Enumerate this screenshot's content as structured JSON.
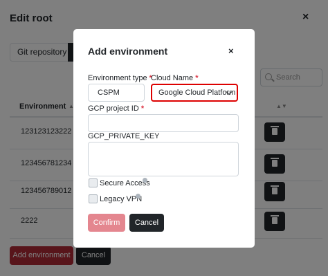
{
  "background": {
    "title": "Edit root",
    "close": "×",
    "tab_label": "Git repository",
    "search_placeholder": "Search",
    "column_header": "Environment",
    "rows": [
      "123123123222",
      "123456781234",
      "123456789012",
      "2222"
    ],
    "add_button": "Add environment",
    "cancel_button": "Cancel"
  },
  "modal": {
    "title": "Add environment",
    "close": "×",
    "env_type_label": "Environment type",
    "env_type_value": "CSPM",
    "cloud_name_label": "Cloud Name",
    "cloud_name_value": "Google Cloud Platform",
    "project_id_label": "GCP project ID",
    "private_key_label": "GCP_PRIVATE_KEY",
    "secure_access_label": "Secure Access",
    "legacy_vpn_label": "Legacy VPN",
    "confirm_button": "Confirm",
    "cancel_button": "Cancel",
    "required_mark": "*"
  },
  "colors": {
    "primary": "#b02a37",
    "dark": "#212529",
    "highlight": "#dd0000"
  }
}
